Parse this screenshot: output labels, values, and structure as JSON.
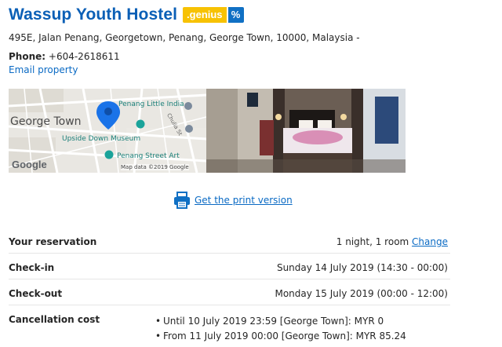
{
  "hotel": {
    "name": "Wassup Youth Hostel",
    "genius_label": ".genius",
    "genius_pct": "%",
    "address": "495E, Jalan Penang, Georgetown, Penang, George Town, 10000, Malaysia -",
    "phone_label": "Phone:",
    "phone_value": "+604-2618611",
    "email_link": "Email property"
  },
  "map": {
    "city_label": "George Town",
    "poi_little_india": "Penang Little India",
    "poi_upside_down": "Upside Down Museum",
    "poi_street_art": "Penang Street Art",
    "street_chulia": "Chulia St",
    "google_logo": "Google",
    "attribution": "Map data ©2019 Google"
  },
  "print": {
    "link_text": "Get the print version"
  },
  "reservation": {
    "rows": [
      {
        "label": "Your reservation",
        "value": "1 night, 1 room",
        "action": "Change"
      },
      {
        "label": "Check-in",
        "value": "Sunday 14 July 2019 (14:30 - 00:00)"
      },
      {
        "label": "Check-out",
        "value": "Monday 15 July 2019 (00:00 - 12:00)"
      },
      {
        "label": "Cancellation cost"
      }
    ],
    "cancellation_items": [
      "Until 10 July 2019 23:59 [George Town]: MYR 0",
      "From 11 July 2019 00:00 [George Town]: MYR 85.24"
    ]
  },
  "colors": {
    "link_blue": "#0a6ac4",
    "title_blue": "#0a5fb6",
    "genius_yellow": "#f7c203",
    "genius_blue": "#1070c4",
    "map_pin": "#1a73e8"
  }
}
